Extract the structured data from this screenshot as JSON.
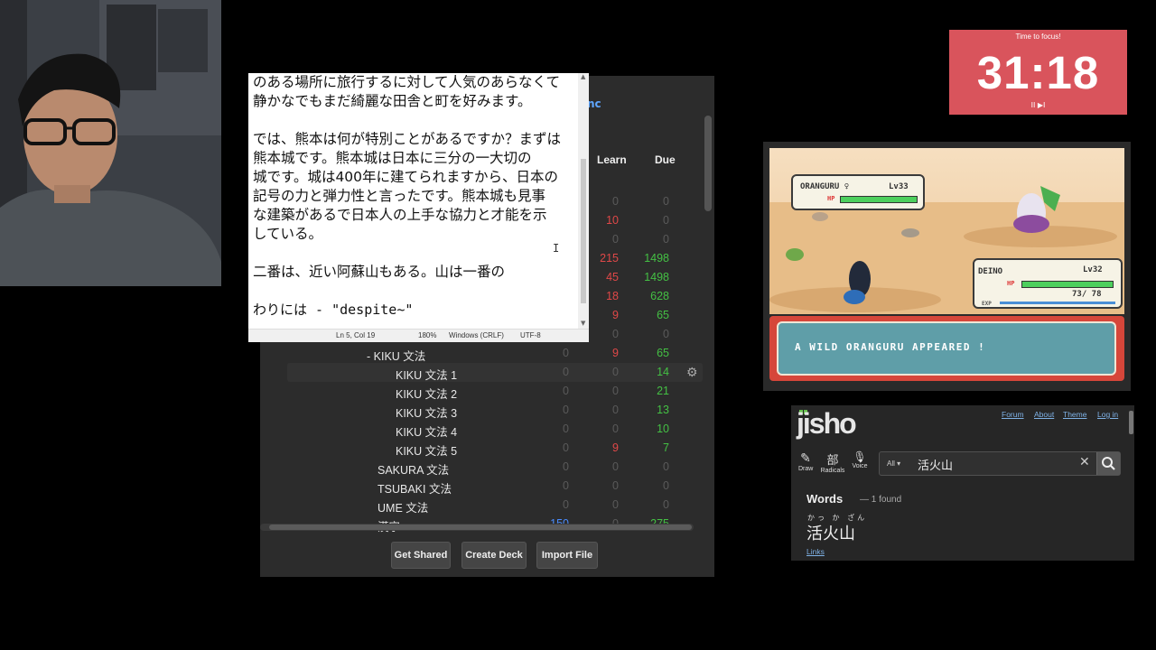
{
  "anki": {
    "sync_label": "nc",
    "col_learn": "Learn",
    "col_due": "Due",
    "rows": [
      {
        "name": "",
        "c1": "",
        "c2": "0",
        "c3": "0"
      },
      {
        "name": "",
        "c1": "",
        "c2": "10",
        "c3": "0"
      },
      {
        "name": "",
        "c1": "",
        "c2": "0",
        "c3": "0"
      },
      {
        "name": "",
        "c1": "",
        "c2": "215",
        "c3": "1498"
      },
      {
        "name": "",
        "c1": "",
        "c2": "45",
        "c3": "1498"
      },
      {
        "name": "",
        "c1": "",
        "c2": "18",
        "c3": "628"
      },
      {
        "name": "",
        "c1": "",
        "c2": "9",
        "c3": "65"
      },
      {
        "name": "",
        "c1": "",
        "c2": "0",
        "c3": "0"
      },
      {
        "name": "-  KIKU 文法",
        "c1": "0",
        "c2": "9",
        "c3": "65"
      },
      {
        "name": "KIKU 文法 1",
        "c1": "0",
        "c2": "0",
        "c3": "14"
      },
      {
        "name": "KIKU 文法 2",
        "c1": "0",
        "c2": "0",
        "c3": "21"
      },
      {
        "name": "KIKU 文法 3",
        "c1": "0",
        "c2": "0",
        "c3": "13"
      },
      {
        "name": "KIKU 文法 4",
        "c1": "0",
        "c2": "0",
        "c3": "10"
      },
      {
        "name": "KIKU 文法 5",
        "c1": "0",
        "c2": "9",
        "c3": "7"
      },
      {
        "name": "SAKURA 文法",
        "c1": "0",
        "c2": "0",
        "c3": "0"
      },
      {
        "name": "TSUBAKI 文法",
        "c1": "0",
        "c2": "0",
        "c3": "0"
      },
      {
        "name": "UME 文法",
        "c1": "0",
        "c2": "0",
        "c3": "0"
      },
      {
        "name": "漢字",
        "c1": "150",
        "c2": "0",
        "c3": "275"
      }
    ],
    "buttons": {
      "get_shared": "Get Shared",
      "create_deck": "Create Deck",
      "import_file": "Import File"
    }
  },
  "notepad": {
    "lines": [
      "のある場所に旅行するに対して人気のあらなくて",
      "静かなでもまだ綺麗な田舎と町を好みます。",
      "",
      "では、熊本は何が特別ことがあるですか？まずは",
      "熊本城です。熊本城は日本に三分の一大切の",
      "城です。城は400年に建てられますから、日本の",
      "記号の力と弾力性と言ったです。熊本城も見事",
      "な建築があるで日本人の上手な協力と才能を示",
      "している。",
      "",
      "二番は、近い阿蘇山もある。山は一番の",
      "",
      "わりには - \"despite~\""
    ],
    "status": {
      "position": "Ln 5, Col 19",
      "zoom": "180%",
      "line_ending": "Windows (CRLF)",
      "encoding": "UTF-8"
    }
  },
  "timer": {
    "label": "Time to focus!",
    "time": "31:18",
    "controls": "II ▶I"
  },
  "game": {
    "enemy": {
      "name": "ORANGURU ♀",
      "level": "Lv33",
      "hp_label": "HP"
    },
    "player": {
      "name": "DEINO",
      "level": "Lv32",
      "hp_label": "HP",
      "hp": "73/ 78",
      "exp_label": "EXP"
    },
    "message": "A WILD ORANGURU APPEARED !"
  },
  "jisho": {
    "logo": "jisho",
    "nav": [
      "Forum",
      "About",
      "Theme",
      "Log in"
    ],
    "tools": {
      "draw_glyph": "✎",
      "draw": "Draw",
      "radicals_glyph": "部",
      "radicals": "Radicals",
      "voice_glyph": "🎙",
      "voice": "Voice"
    },
    "search": {
      "filter": "All ▾",
      "query": "活火山",
      "clear": "✕"
    },
    "words_heading": "Words",
    "found": "— 1 found",
    "furigana": "かっ か ざん",
    "word": "活火山",
    "links": "Links"
  },
  "colors": {
    "anki_bg": "#2c2c2c",
    "timer_bg": "#d9545c",
    "learn_red": "#e04848",
    "due_green": "#44c044",
    "new_blue": "#4a8cff"
  }
}
